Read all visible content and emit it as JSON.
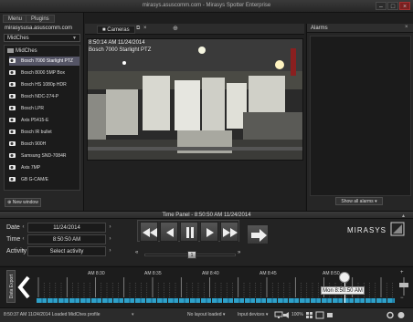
{
  "window": {
    "title": "mirasys.asuscomm.com - Mirasys Spotter Enterprise",
    "buttons": [
      "minimize",
      "maximize",
      "close"
    ]
  },
  "left_panel": {
    "tabs": [
      "Menu",
      "Plugins"
    ],
    "server": "mirasysusa.asuscomm.com",
    "group_select": "MidChes",
    "tree_root": "MidChes",
    "cameras": [
      "Bosch 7000 Starlight PTZ",
      "Bosch 8000 5MP Box",
      "Bosch HS 1080p HDR",
      "Bosch NDC-274-P",
      "Bosch LPR",
      "Axis P5415-E",
      "Bosch IR bullet",
      "Bosch 900H",
      "Samsung SND-7084R",
      "Axis 7MP",
      "GB G-CAM/E"
    ],
    "selected_index": 0,
    "new_window_label": "New window"
  },
  "camera_panel": {
    "tab_label": "Cameras",
    "overlay_time": "8:50:14 AM  11/24/2014",
    "overlay_name": "Bosch 7000 Starlight PTZ"
  },
  "alarms_panel": {
    "title": "Alarms",
    "show_all_label": "Show all alarms"
  },
  "time_panel": {
    "title": "Time Panel - 8:50:50 AM 11/24/2014",
    "date_label": "Date",
    "date_value": "11/24/2014",
    "time_label": "Time",
    "time_value": "8:50:50 AM",
    "activity_label": "Activity",
    "activity_value": "Select activity",
    "speed_value": "1",
    "brand": "MIRASYS"
  },
  "timeline": {
    "tab_label": "Data Export",
    "ticks": [
      "AM 8:30",
      "AM 8:35",
      "AM 8:40",
      "AM 8:45",
      "AM 8:50"
    ],
    "cursor_label": "Mon 8:50:50 AM"
  },
  "statusbar": {
    "text": "8:50:37 AM  11/24/2014 Loaded MidChes profile",
    "layout": "No layout loaded",
    "input": "Input devices",
    "zoom": "100%"
  },
  "colors": {
    "accent": "#2ea0c8",
    "selected": "#556",
    "background": "#1e1e1e"
  }
}
